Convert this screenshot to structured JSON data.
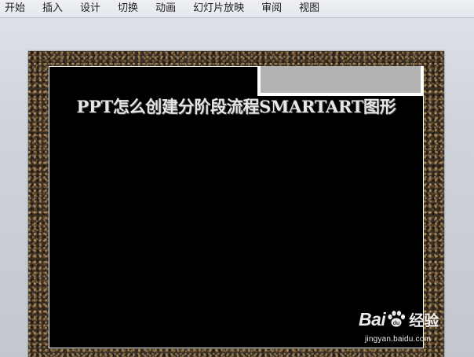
{
  "ribbon": {
    "tabs": [
      {
        "label": "开始"
      },
      {
        "label": "插入"
      },
      {
        "label": "设计"
      },
      {
        "label": "切换"
      },
      {
        "label": "动画"
      },
      {
        "label": "幻灯片放映"
      },
      {
        "label": "审阅"
      },
      {
        "label": "视图"
      }
    ]
  },
  "slide": {
    "title": "PPT怎么创建分阶段流程SMARTART图形"
  },
  "watermark": {
    "brand_left": "Bai",
    "brand_right": "经验",
    "url": "jingyan.baidu.com"
  },
  "colors": {
    "ribbon_bg": "#e4e7ec",
    "slide_bg": "#000000",
    "slide_border": "#ffffff",
    "title_text": "#e6e6e6",
    "title_tab": "#b2b2b2",
    "frame_texture": "#3a2f24"
  }
}
